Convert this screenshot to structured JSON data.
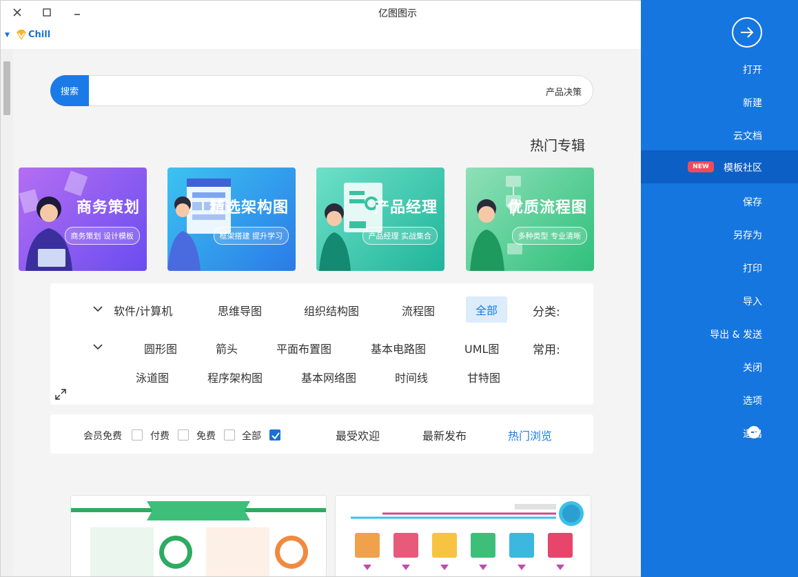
{
  "window": {
    "title": "亿图图示",
    "user_name": "Chill"
  },
  "search": {
    "button_label": "搜索",
    "query": "产品决策"
  },
  "section_title": "热门专辑",
  "banners": [
    {
      "title": "优质流程图",
      "subtitle": "多种类型 专业清晰"
    },
    {
      "title": "产品经理",
      "subtitle": "产品经理 实战集合"
    },
    {
      "title": "精选架构图",
      "subtitle": "框架搭建 提升学习"
    },
    {
      "title": "商务策划",
      "subtitle": "商务策划 设计模板"
    }
  ],
  "categories": {
    "label": "分类:",
    "items": [
      "全部",
      "流程图",
      "组织结构图",
      "思维导图",
      "软件/计算机"
    ]
  },
  "common": {
    "label": "常用:",
    "row1": [
      "UML图",
      "基本电路图",
      "平面布置图",
      "箭头",
      "圆形图"
    ],
    "row2": [
      "甘特图",
      "时间线",
      "基本网络图",
      "程序架构图",
      "泳道图"
    ]
  },
  "sort": {
    "tabs": [
      "热门浏览",
      "最新发布",
      "最受欢迎"
    ],
    "filters": [
      "全部",
      "免费",
      "付费",
      "会员免费"
    ]
  },
  "sidebar": {
    "items": [
      {
        "label": "打开"
      },
      {
        "label": "新建"
      },
      {
        "label": "云文档"
      },
      {
        "label": "模板社区",
        "badge": "NEW"
      },
      {
        "label": "保存"
      },
      {
        "label": "另存为"
      },
      {
        "label": "打印"
      },
      {
        "label": "导入"
      },
      {
        "label": "导出 & 发送"
      },
      {
        "label": "关闭"
      },
      {
        "label": "选项"
      },
      {
        "label": "退出"
      }
    ]
  },
  "colors": {
    "sidebar": "#1676e0",
    "sidebar_active": "#0c5fc4",
    "accent": "#1a7be8",
    "new_badge": "#f04b5a"
  }
}
